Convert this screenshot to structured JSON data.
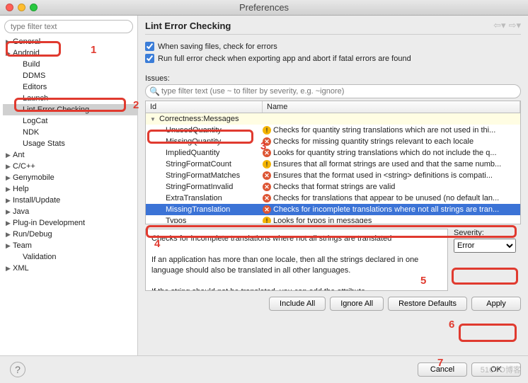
{
  "window": {
    "title": "Preferences"
  },
  "sidebar": {
    "filter_placeholder": "type filter text",
    "items": [
      {
        "label": "General",
        "lvl": 0,
        "exp": true
      },
      {
        "label": "Android",
        "lvl": 0,
        "exp": true,
        "hl": true
      },
      {
        "label": "Build",
        "lvl": 1
      },
      {
        "label": "DDMS",
        "lvl": 1
      },
      {
        "label": "Editors",
        "lvl": 1
      },
      {
        "label": "Launch",
        "lvl": 1
      },
      {
        "label": "Lint Error Checking",
        "lvl": 1,
        "sel": true,
        "hl": true
      },
      {
        "label": "LogCat",
        "lvl": 1
      },
      {
        "label": "NDK",
        "lvl": 1
      },
      {
        "label": "Usage Stats",
        "lvl": 1
      },
      {
        "label": "Ant",
        "lvl": 0,
        "exp": true
      },
      {
        "label": "C/C++",
        "lvl": 0,
        "exp": true
      },
      {
        "label": "Genymobile",
        "lvl": 0,
        "exp": true
      },
      {
        "label": "Help",
        "lvl": 0,
        "exp": true
      },
      {
        "label": "Install/Update",
        "lvl": 0,
        "exp": true
      },
      {
        "label": "Java",
        "lvl": 0,
        "exp": true
      },
      {
        "label": "Plug-in Development",
        "lvl": 0,
        "exp": true
      },
      {
        "label": "Run/Debug",
        "lvl": 0,
        "exp": true
      },
      {
        "label": "Team",
        "lvl": 0,
        "exp": true
      },
      {
        "label": "Validation",
        "lvl": 1
      },
      {
        "label": "XML",
        "lvl": 0,
        "exp": true
      }
    ]
  },
  "page": {
    "title": "Lint Error Checking",
    "check1": "When saving files, check for errors",
    "check2": "Run full error check when exporting app and abort if fatal errors are found",
    "issues_label": "Issues:",
    "issues_filter_placeholder": "type filter text (use ~ to filter by severity, e.g. ~ignore)",
    "col_id": "Id",
    "col_name": "Name",
    "group": "Correctness:Messages",
    "rows": [
      {
        "id": "UnusedQuantity",
        "sev": "warn",
        "name": "Checks for quantity string translations which are not used in thi..."
      },
      {
        "id": "MissingQuantity",
        "sev": "err",
        "name": "Checks for missing quantity strings relevant to each locale"
      },
      {
        "id": "ImpliedQuantity",
        "sev": "err",
        "name": "Looks for quantity string translations which do not include the q..."
      },
      {
        "id": "StringFormatCount",
        "sev": "warn",
        "name": "Ensures that all format strings are used and that the same numb..."
      },
      {
        "id": "StringFormatMatches",
        "sev": "err",
        "name": "Ensures that the format used in <string> definitions is compati..."
      },
      {
        "id": "StringFormatInvalid",
        "sev": "err",
        "name": "Checks that format strings are valid"
      },
      {
        "id": "ExtraTranslation",
        "sev": "err",
        "name": "Checks for translations that appear to be unused (no default lan..."
      },
      {
        "id": "MissingTranslation",
        "sev": "err",
        "name": "Checks for incomplete translations where not all strings are tran...",
        "sel": true
      },
      {
        "id": "Typos",
        "sev": "warn",
        "name": "Looks for typos in messages"
      }
    ],
    "desc_line1": "Checks for incomplete translations where not all strings are translated",
    "desc_line2": "If an application has more than one locale, then all the strings declared in one language should also be translated in all other languages.",
    "desc_line3": "If the string should not be translated, you can add the attribute",
    "severity_label": "Severity:",
    "severity_value": "Error",
    "btn_include": "Include All",
    "btn_ignore": "Ignore All",
    "btn_restore": "Restore Defaults",
    "btn_apply": "Apply",
    "btn_cancel": "Cancel",
    "btn_ok": "OK"
  },
  "watermark": "51CTO博客",
  "annotations": {
    "n1": "1",
    "n2": "2",
    "n3": "3",
    "n4": "4",
    "n5": "5",
    "n6": "6",
    "n7": "7"
  }
}
